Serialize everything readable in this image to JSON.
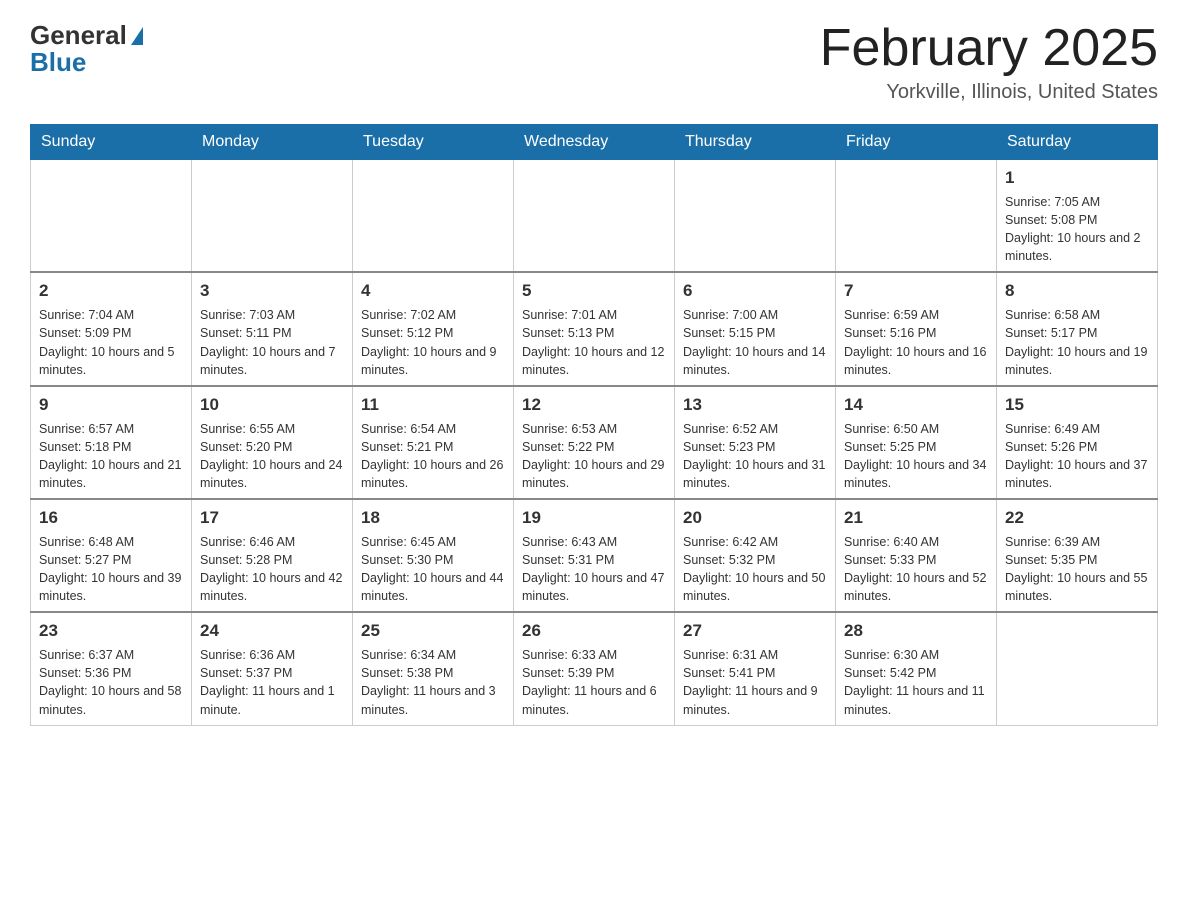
{
  "header": {
    "logo_general": "General",
    "logo_blue": "Blue",
    "month_title": "February 2025",
    "location": "Yorkville, Illinois, United States"
  },
  "weekdays": [
    "Sunday",
    "Monday",
    "Tuesday",
    "Wednesday",
    "Thursday",
    "Friday",
    "Saturday"
  ],
  "weeks": [
    [
      {
        "day": "",
        "sunrise": "",
        "sunset": "",
        "daylight": ""
      },
      {
        "day": "",
        "sunrise": "",
        "sunset": "",
        "daylight": ""
      },
      {
        "day": "",
        "sunrise": "",
        "sunset": "",
        "daylight": ""
      },
      {
        "day": "",
        "sunrise": "",
        "sunset": "",
        "daylight": ""
      },
      {
        "day": "",
        "sunrise": "",
        "sunset": "",
        "daylight": ""
      },
      {
        "day": "",
        "sunrise": "",
        "sunset": "",
        "daylight": ""
      },
      {
        "day": "1",
        "sunrise": "Sunrise: 7:05 AM",
        "sunset": "Sunset: 5:08 PM",
        "daylight": "Daylight: 10 hours and 2 minutes."
      }
    ],
    [
      {
        "day": "2",
        "sunrise": "Sunrise: 7:04 AM",
        "sunset": "Sunset: 5:09 PM",
        "daylight": "Daylight: 10 hours and 5 minutes."
      },
      {
        "day": "3",
        "sunrise": "Sunrise: 7:03 AM",
        "sunset": "Sunset: 5:11 PM",
        "daylight": "Daylight: 10 hours and 7 minutes."
      },
      {
        "day": "4",
        "sunrise": "Sunrise: 7:02 AM",
        "sunset": "Sunset: 5:12 PM",
        "daylight": "Daylight: 10 hours and 9 minutes."
      },
      {
        "day": "5",
        "sunrise": "Sunrise: 7:01 AM",
        "sunset": "Sunset: 5:13 PM",
        "daylight": "Daylight: 10 hours and 12 minutes."
      },
      {
        "day": "6",
        "sunrise": "Sunrise: 7:00 AM",
        "sunset": "Sunset: 5:15 PM",
        "daylight": "Daylight: 10 hours and 14 minutes."
      },
      {
        "day": "7",
        "sunrise": "Sunrise: 6:59 AM",
        "sunset": "Sunset: 5:16 PM",
        "daylight": "Daylight: 10 hours and 16 minutes."
      },
      {
        "day": "8",
        "sunrise": "Sunrise: 6:58 AM",
        "sunset": "Sunset: 5:17 PM",
        "daylight": "Daylight: 10 hours and 19 minutes."
      }
    ],
    [
      {
        "day": "9",
        "sunrise": "Sunrise: 6:57 AM",
        "sunset": "Sunset: 5:18 PM",
        "daylight": "Daylight: 10 hours and 21 minutes."
      },
      {
        "day": "10",
        "sunrise": "Sunrise: 6:55 AM",
        "sunset": "Sunset: 5:20 PM",
        "daylight": "Daylight: 10 hours and 24 minutes."
      },
      {
        "day": "11",
        "sunrise": "Sunrise: 6:54 AM",
        "sunset": "Sunset: 5:21 PM",
        "daylight": "Daylight: 10 hours and 26 minutes."
      },
      {
        "day": "12",
        "sunrise": "Sunrise: 6:53 AM",
        "sunset": "Sunset: 5:22 PM",
        "daylight": "Daylight: 10 hours and 29 minutes."
      },
      {
        "day": "13",
        "sunrise": "Sunrise: 6:52 AM",
        "sunset": "Sunset: 5:23 PM",
        "daylight": "Daylight: 10 hours and 31 minutes."
      },
      {
        "day": "14",
        "sunrise": "Sunrise: 6:50 AM",
        "sunset": "Sunset: 5:25 PM",
        "daylight": "Daylight: 10 hours and 34 minutes."
      },
      {
        "day": "15",
        "sunrise": "Sunrise: 6:49 AM",
        "sunset": "Sunset: 5:26 PM",
        "daylight": "Daylight: 10 hours and 37 minutes."
      }
    ],
    [
      {
        "day": "16",
        "sunrise": "Sunrise: 6:48 AM",
        "sunset": "Sunset: 5:27 PM",
        "daylight": "Daylight: 10 hours and 39 minutes."
      },
      {
        "day": "17",
        "sunrise": "Sunrise: 6:46 AM",
        "sunset": "Sunset: 5:28 PM",
        "daylight": "Daylight: 10 hours and 42 minutes."
      },
      {
        "day": "18",
        "sunrise": "Sunrise: 6:45 AM",
        "sunset": "Sunset: 5:30 PM",
        "daylight": "Daylight: 10 hours and 44 minutes."
      },
      {
        "day": "19",
        "sunrise": "Sunrise: 6:43 AM",
        "sunset": "Sunset: 5:31 PM",
        "daylight": "Daylight: 10 hours and 47 minutes."
      },
      {
        "day": "20",
        "sunrise": "Sunrise: 6:42 AM",
        "sunset": "Sunset: 5:32 PM",
        "daylight": "Daylight: 10 hours and 50 minutes."
      },
      {
        "day": "21",
        "sunrise": "Sunrise: 6:40 AM",
        "sunset": "Sunset: 5:33 PM",
        "daylight": "Daylight: 10 hours and 52 minutes."
      },
      {
        "day": "22",
        "sunrise": "Sunrise: 6:39 AM",
        "sunset": "Sunset: 5:35 PM",
        "daylight": "Daylight: 10 hours and 55 minutes."
      }
    ],
    [
      {
        "day": "23",
        "sunrise": "Sunrise: 6:37 AM",
        "sunset": "Sunset: 5:36 PM",
        "daylight": "Daylight: 10 hours and 58 minutes."
      },
      {
        "day": "24",
        "sunrise": "Sunrise: 6:36 AM",
        "sunset": "Sunset: 5:37 PM",
        "daylight": "Daylight: 11 hours and 1 minute."
      },
      {
        "day": "25",
        "sunrise": "Sunrise: 6:34 AM",
        "sunset": "Sunset: 5:38 PM",
        "daylight": "Daylight: 11 hours and 3 minutes."
      },
      {
        "day": "26",
        "sunrise": "Sunrise: 6:33 AM",
        "sunset": "Sunset: 5:39 PM",
        "daylight": "Daylight: 11 hours and 6 minutes."
      },
      {
        "day": "27",
        "sunrise": "Sunrise: 6:31 AM",
        "sunset": "Sunset: 5:41 PM",
        "daylight": "Daylight: 11 hours and 9 minutes."
      },
      {
        "day": "28",
        "sunrise": "Sunrise: 6:30 AM",
        "sunset": "Sunset: 5:42 PM",
        "daylight": "Daylight: 11 hours and 11 minutes."
      },
      {
        "day": "",
        "sunrise": "",
        "sunset": "",
        "daylight": ""
      }
    ]
  ]
}
